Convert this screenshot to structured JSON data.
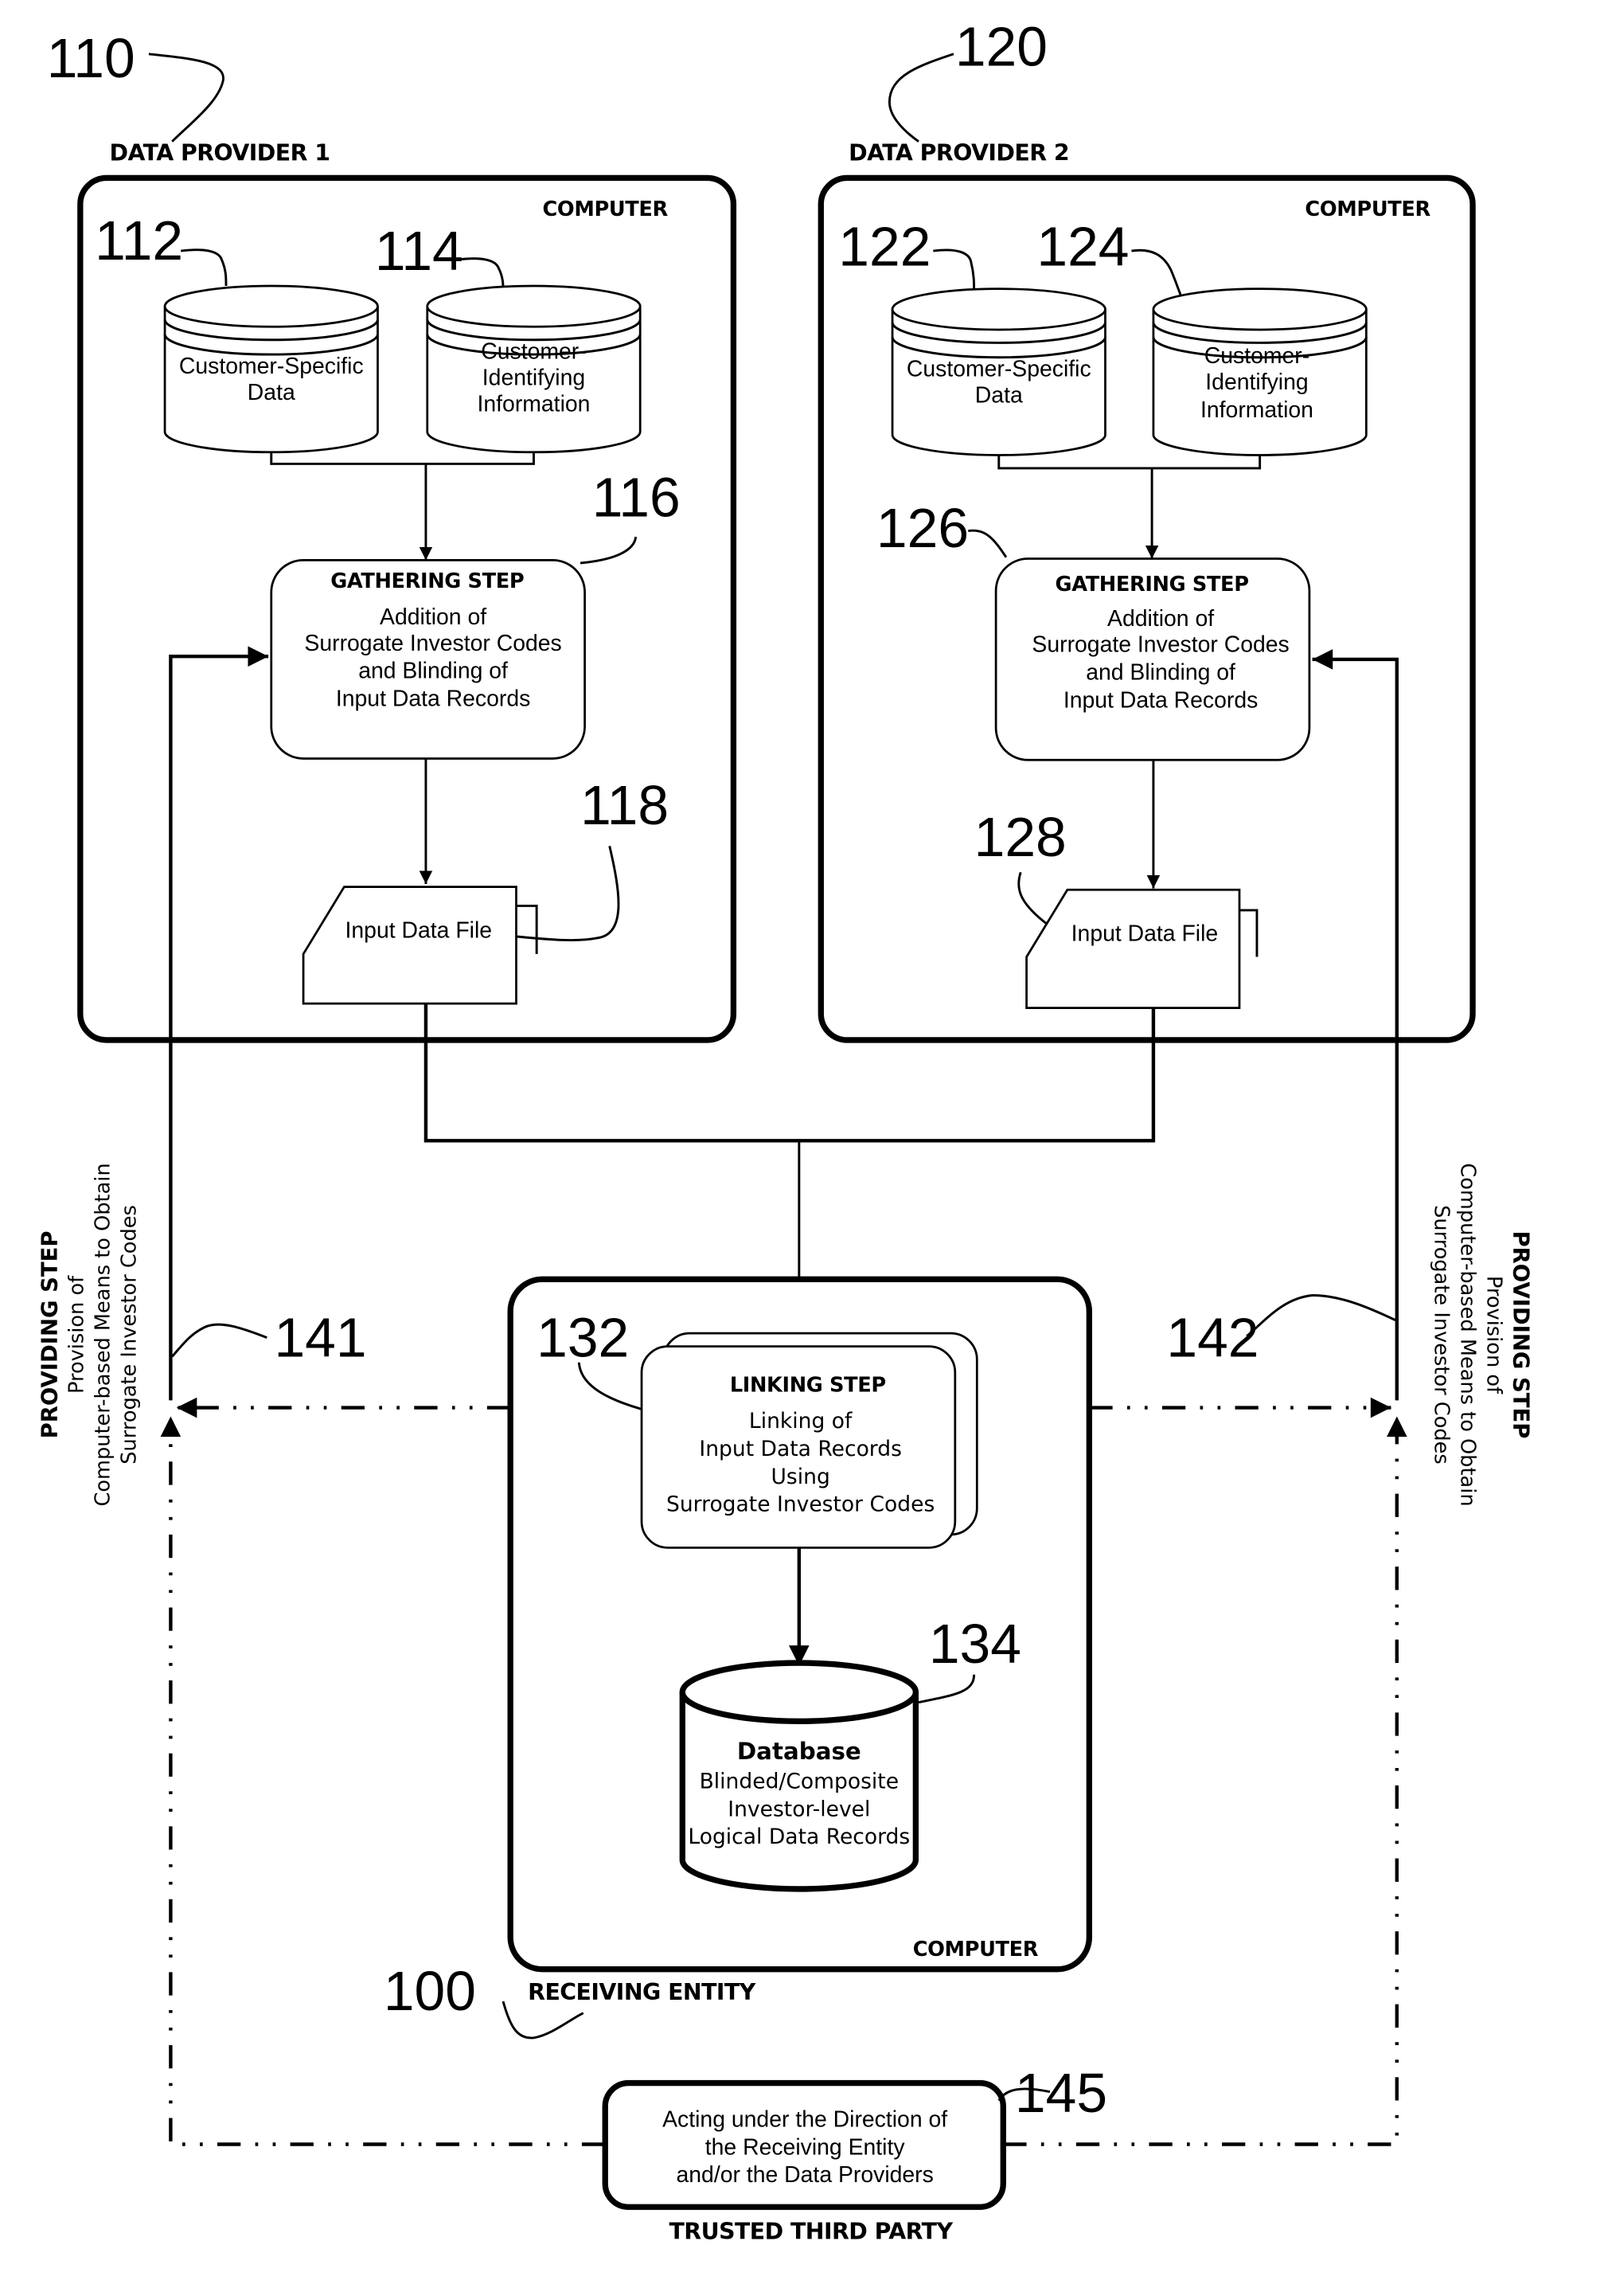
{
  "figure": {
    "data_provider_1": {
      "ref": "110",
      "label": "DATA PROVIDER 1",
      "computer_label": "COMPUTER",
      "db_specific": {
        "ref": "112",
        "lines": [
          "Customer-Specific",
          "Data"
        ]
      },
      "db_identifying": {
        "ref": "114",
        "lines": [
          "Customer-",
          "Identifying",
          "Information"
        ]
      },
      "gathering": {
        "ref": "116",
        "title": "GATHERING STEP",
        "lines": [
          "Addition of",
          "Surrogate Investor Codes",
          "and Blinding of",
          "Input Data Records"
        ]
      },
      "file": {
        "ref": "118",
        "label": "Input Data File"
      }
    },
    "data_provider_2": {
      "ref": "120",
      "label": "DATA PROVIDER 2",
      "computer_label": "COMPUTER",
      "db_specific": {
        "ref": "122",
        "lines": [
          "Customer-Specific",
          "Data"
        ]
      },
      "db_identifying": {
        "ref": "124",
        "lines": [
          "Customer-",
          "Identifying",
          "Information"
        ]
      },
      "gathering": {
        "ref": "126",
        "title": "GATHERING STEP",
        "lines": [
          "Addition of",
          "Surrogate Investor Codes",
          "and Blinding of",
          "Input Data Records"
        ]
      },
      "file": {
        "ref": "128",
        "label": "Input Data File"
      }
    },
    "receiving_entity": {
      "ref": "100",
      "label": "RECEIVING ENTITY",
      "computer_label": "COMPUTER",
      "linking": {
        "ref": "132",
        "title": "LINKING STEP",
        "lines": [
          "Linking of",
          "Input Data Records",
          "Using",
          "Surrogate Investor Codes"
        ]
      },
      "database": {
        "ref": "134",
        "title": "Database",
        "lines": [
          "Blinded/Composite",
          "Investor-level",
          "Logical Data Records"
        ]
      }
    },
    "providing_left": {
      "ref": "141",
      "title": "PROVIDING STEP",
      "lines": [
        "Provision of",
        "Computer-based Means to Obtain",
        "Surrogate Investor Codes"
      ]
    },
    "providing_right": {
      "ref": "142",
      "title": "PROVIDING STEP",
      "lines": [
        "Provision of",
        "Computer-based Means to Obtain",
        "Surrogate Investor Codes"
      ]
    },
    "trusted_third_party": {
      "ref": "145",
      "label": "TRUSTED THIRD PARTY",
      "lines": [
        "Acting under the Direction of",
        "the Receiving Entity",
        "and/or the Data Providers"
      ]
    }
  }
}
